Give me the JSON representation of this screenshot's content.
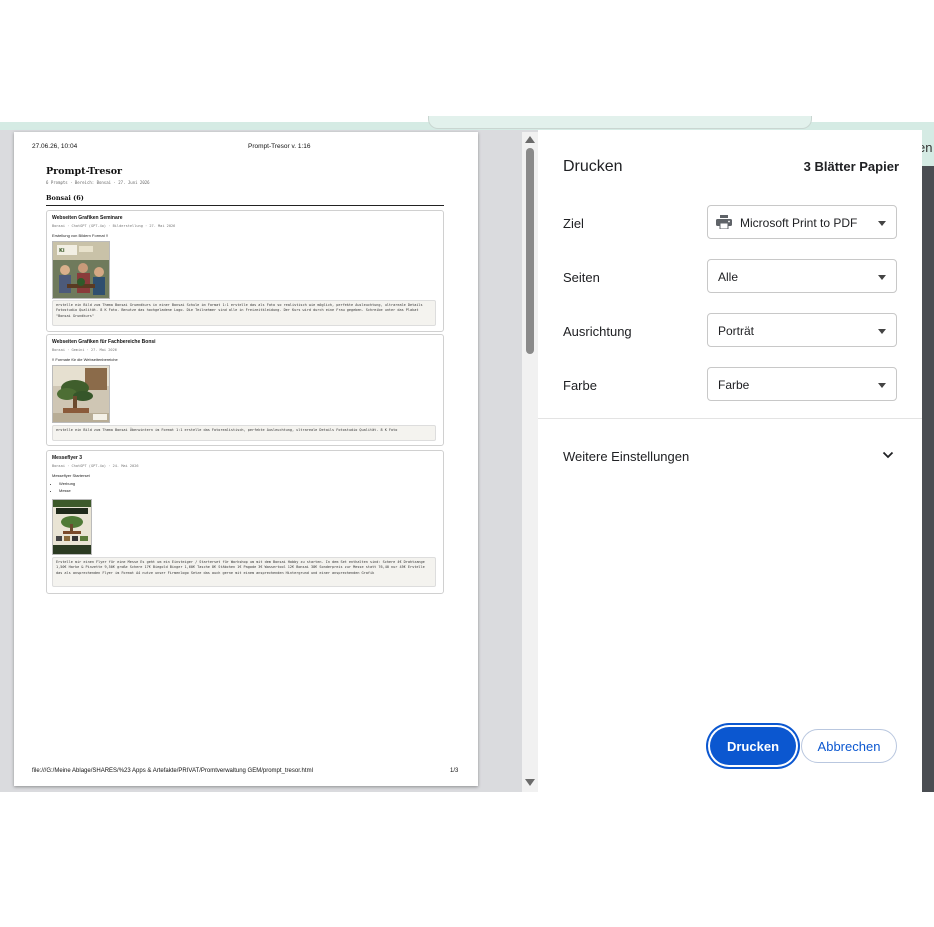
{
  "background": {
    "right_fragment": "en"
  },
  "preview": {
    "header_datetime": "27.06.26, 10:04",
    "header_title": "Prompt-Tresor v. 1:16",
    "doc_title": "Prompt-Tresor",
    "doc_meta": "6 Prompts · Bereich: Bonsai · 27. Juni 2026",
    "section": "Bonsai (6)",
    "cards": [
      {
        "title": "Webseiten Grafiken Seminare",
        "meta": "Bonsai · ChatGPT (GPT-4o) · Bilderstellung · 27. Mai 2026",
        "desc": "Erstellung von Bildern Format !!",
        "prompt": "erstelle ein Bild zum Thema Bonsai Gruendkurs in einer Bonsai Schule im Format 1:1 erstelle das als Foto so realistisch wie möglich, perfekte Ausleuchtung, ultrareale Details Fotostudio Qualität. 8 K Foto. Benutze das hochgeladene Logo. Die Teilnehmer sind alle in Freizeitkleidung. Der Kurs wird durch eine Frau gegeben. Schreibe unter das Plakat \"Bonsai Grundkurs\""
      },
      {
        "title": "Webseiten Grafiken für Fachbereiche Bonsi",
        "meta": "Bonsai · Gemini · 27. Mai 2026",
        "desc": "!! Formate für die Webseitenbereiche",
        "prompt": "erstelle ein Bild zum Thema Bonsai Überwintern im Format 1:1 erstelle das Fotorealistisch, perfekte Ausleuchtung, ultrareale Details Fotostudio Qualität. 8 K Foto"
      },
      {
        "title": "Messeflyer 3",
        "meta": "Bonsai · ChatGPT (GPT-4o) · 24. Mai 2026",
        "desc": "Messeflyer Starterset",
        "bullets": [
          "Werbung",
          "Messe"
        ],
        "prompt": "Erstelle mir einen Flyer für eine Messe Es geht um ein Einsteiger / Starterset für Workshop um mit dem Bonsai Hobby zu starten. In dem Set enthalten sind: Schere 4€ Drahtzange 1,50€ Harke & Pinzette 9,50€ große Schere 17€ Biegold Binger 1,60€ Tasche 8€ Stäbchen 1€ Pagode 3€ Wassertool 12€ Bonsai 38€ Sonderpreis zur Messe statt 76,40 nur 45€ Erstelle das als ansprechenden Flyer im Format A4 nutze unser Firmenlogo Setze das auch gerne mit einem ansprechenden Hintergrund und einer ansprechenden Grafik"
      }
    ],
    "footer_path": "file:///G:/Meine Ablage/SHARES/%23 Apps & Artefakte/PRIVAT/Promtverwaltung GEM/prompt_tresor.html",
    "footer_page": "1/3"
  },
  "panel": {
    "title": "Drucken",
    "sheet_count": "3 Blätter Papier",
    "rows": {
      "destination": {
        "label": "Ziel",
        "value": "Microsoft Print to PDF",
        "icon": "printer-icon"
      },
      "pages": {
        "label": "Seiten",
        "value": "Alle"
      },
      "orientation": {
        "label": "Ausrichtung",
        "value": "Porträt"
      },
      "color": {
        "label": "Farbe",
        "value": "Farbe"
      }
    },
    "more_settings": "Weitere Einstellungen",
    "print_button": "Drucken",
    "cancel_button": "Abbrechen"
  },
  "colors": {
    "accent": "#0b57d0",
    "preview_bg": "#dadbde",
    "browser_strip": "#d5ebe4"
  }
}
